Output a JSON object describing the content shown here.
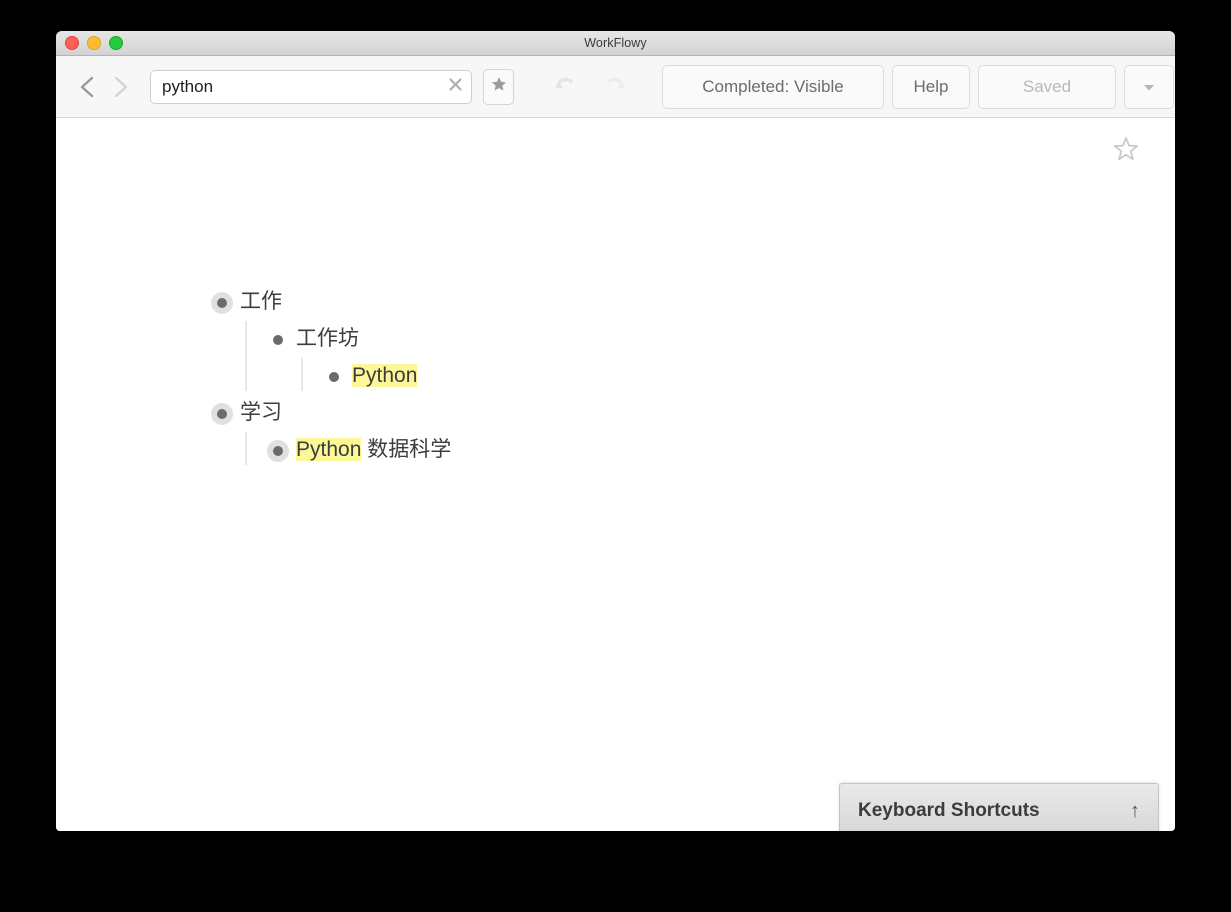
{
  "window": {
    "title": "WorkFlowy",
    "traffic_lights": [
      "close",
      "minimize",
      "maximize"
    ]
  },
  "toolbar": {
    "back_icon": "chevron-left-icon",
    "forward_icon": "chevron-right-icon",
    "search_value": "python",
    "search_placeholder": "Search",
    "clear_icon": "close-x-icon",
    "starred_icon": "star-filled-icon",
    "undo_icon": "undo-arrow-icon",
    "redo_icon": "redo-arrow-icon",
    "completed_label": "Completed: Visible",
    "help_label": "Help",
    "saved_label": "Saved",
    "dropdown_icon": "chevron-down-icon"
  },
  "page": {
    "star_icon": "star-outline-icon"
  },
  "outline": {
    "nodes": [
      {
        "id": "work",
        "text": "工作",
        "has_children": true,
        "children": [
          {
            "id": "workshop",
            "text": "工作坊",
            "has_children": false,
            "children": [
              {
                "id": "python-leaf",
                "text_highlight": "Python",
                "text_rest": "",
                "has_children": false,
                "children": []
              }
            ]
          }
        ]
      },
      {
        "id": "study",
        "text": "学习",
        "has_children": true,
        "children": [
          {
            "id": "python-data-science",
            "text_highlight": "Python",
            "text_rest": " 数据科学",
            "has_children": true,
            "children": []
          }
        ]
      }
    ]
  },
  "keyboard_shortcuts": {
    "label": "Keyboard Shortcuts",
    "arrow": "↑",
    "arrow_icon": "arrow-up-icon"
  },
  "colors": {
    "highlight": "#fcf897",
    "bullet": "#6b6b6b",
    "bullet_halo": "#e0e0e0",
    "text": "#3d3d3d",
    "toolbar_bg": "#f7f7f7",
    "titlebar_bg": "#d9d9d9",
    "desktop_bg": "#000000"
  }
}
